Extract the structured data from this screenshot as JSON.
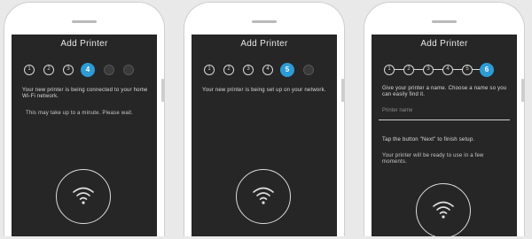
{
  "colors": {
    "accent": "#2d9bd6",
    "screen": "#262626",
    "frame": "#ffffff"
  },
  "phones": [
    {
      "title": "Add Printer",
      "header_left": "",
      "header_right": "",
      "active_step": "4",
      "paragraph1": "Your new printer is being connected to your home Wi-Fi network.",
      "paragraph2": "This may take up to a minute. Please wait.",
      "icon": "wifi-icon"
    },
    {
      "title": "Add Printer",
      "header_left": "",
      "header_right": "",
      "active_step": "5",
      "paragraph1": "Your new printer is being set up on your network.",
      "icon": "wifi-icon"
    },
    {
      "title": "Add Printer",
      "header_left": "",
      "header_right": "",
      "active_step": "6",
      "paragraph1": "Give your printer a name. Choose a name so you can easily find it.",
      "field_placeholder": "Printer name",
      "paragraph2": "Tap the button \"Next\" to finish setup.",
      "paragraph3": "Your printer will be ready to use in a few moments.",
      "icon": "wifi-icon"
    }
  ]
}
